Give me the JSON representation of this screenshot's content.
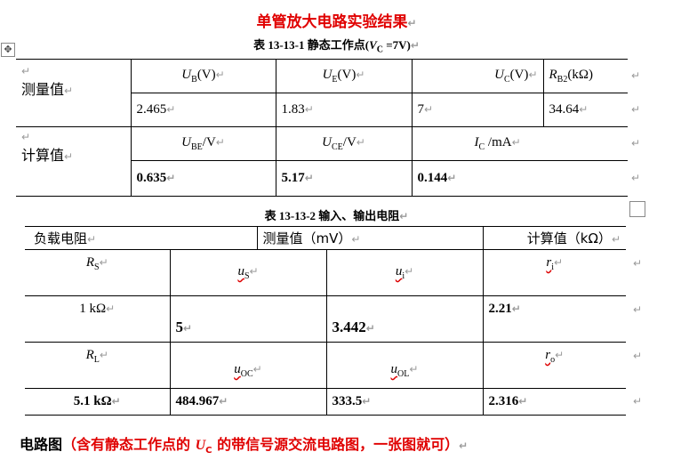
{
  "title": "单管放大电路实验结果",
  "table1": {
    "caption_prefix": "表 13-13-1 静态工作点(",
    "caption_var": "V",
    "caption_sub": "C",
    "caption_suffix": " =7V)",
    "measured": {
      "label": "测量值",
      "headers": [
        {
          "var": "U",
          "sub": "B",
          "unit": "(V)"
        },
        {
          "var": "U",
          "sub": "E",
          "unit": "(V)"
        },
        {
          "var": "U",
          "sub": "C",
          "unit": "(V)"
        },
        {
          "var": "R",
          "sub": "B2",
          "unit": "(kΩ)"
        }
      ],
      "values": [
        "2.465",
        "1.83",
        "7",
        "34.64"
      ]
    },
    "calculated": {
      "label": "计算值",
      "headers": [
        {
          "var": "U",
          "sub": "BE",
          "unit": "/V"
        },
        {
          "var": "U",
          "sub": "CE",
          "unit": "/V"
        },
        {
          "var": "I",
          "sub": "C",
          "unit": " /mA"
        }
      ],
      "values": [
        "0.635",
        "5.17",
        "0.144"
      ]
    }
  },
  "table2": {
    "caption": "表 13-13-2 输入、输出电阻",
    "headers": [
      "负载电阻",
      "测量值（mV）",
      "计算值（kΩ）"
    ],
    "row_in_head": {
      "r": "R",
      "r_sub": "S",
      "u1": "u",
      "u1_sub": "S",
      "u2": "u",
      "u2_sub": "i",
      "res": "r",
      "res_sub": "i"
    },
    "row_in_vals": [
      "1 kΩ",
      "5",
      "3.442",
      "2.21"
    ],
    "row_out_head": {
      "r": "R",
      "r_sub": "L",
      "u1": "u",
      "u1_sub": "OC",
      "u2": "u",
      "u2_sub": "OL",
      "res": "r",
      "res_sub": "o"
    },
    "row_out_vals": [
      "5.1 kΩ",
      "484.967",
      "333.5",
      "2.316"
    ]
  },
  "footer": {
    "lead": "电路图",
    "part1": "（含有静态工作点的 ",
    "var": "U",
    "sub": "C",
    "part2": " 的带信号源交流电路图，一张图就可）"
  },
  "marks": {
    "return": "↵",
    "move": "✥"
  }
}
